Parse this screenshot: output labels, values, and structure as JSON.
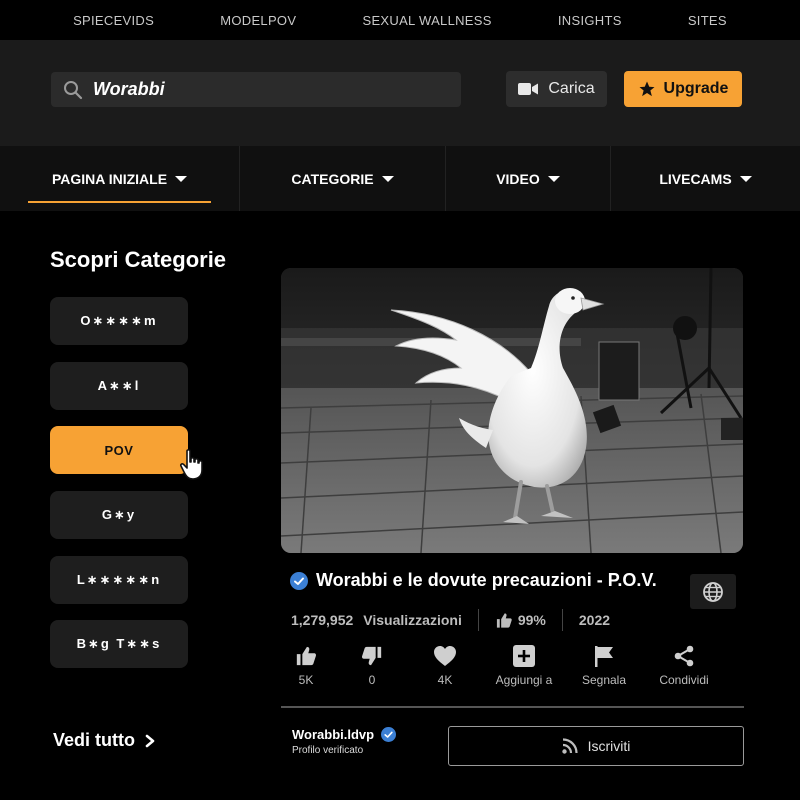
{
  "topbar": {
    "links": [
      "SPIECEVIDS",
      "MODELPOV",
      "SEXUAL WALLNESS",
      "INSIGHTS",
      "SITES"
    ]
  },
  "header": {
    "search_value": "Worabbi",
    "upload_label": "Carica",
    "upgrade_label": "Upgrade"
  },
  "nav": {
    "items": [
      {
        "label": "PAGINA INIZIALE",
        "active": true
      },
      {
        "label": "CATEGORIE"
      },
      {
        "label": "VIDEO"
      },
      {
        "label": "LIVECAMS"
      }
    ]
  },
  "sidebar": {
    "title": "Scopri Categorie",
    "categories": [
      "O∗∗∗∗m",
      "A∗∗l",
      "POV",
      "G∗y",
      "L∗∗∗∗∗n",
      "B∗g T∗∗s"
    ],
    "active_index": 2,
    "see_all": "Vedi tutto"
  },
  "video": {
    "title": "Worabbi e le dovute precauzioni - P.O.V.",
    "views": "1,279,952",
    "views_label": "Visualizzazioni",
    "rating": "99%",
    "year": "2022"
  },
  "actions": [
    {
      "icon": "thumbs-up-icon",
      "label": "5K"
    },
    {
      "icon": "thumbs-down-icon",
      "label": "0"
    },
    {
      "icon": "heart-icon",
      "label": "4K"
    },
    {
      "icon": "add-icon",
      "label": "Aggiungi a"
    },
    {
      "icon": "flag-icon",
      "label": "Segnala"
    },
    {
      "icon": "share-icon",
      "label": "Condividi"
    }
  ],
  "channel": {
    "name": "Worabbi.ldvp",
    "status": "Profilo verificato",
    "subscribe_label": "Iscriviti"
  },
  "colors": {
    "accent": "#f7a234",
    "verified": "#3b7fd4"
  }
}
